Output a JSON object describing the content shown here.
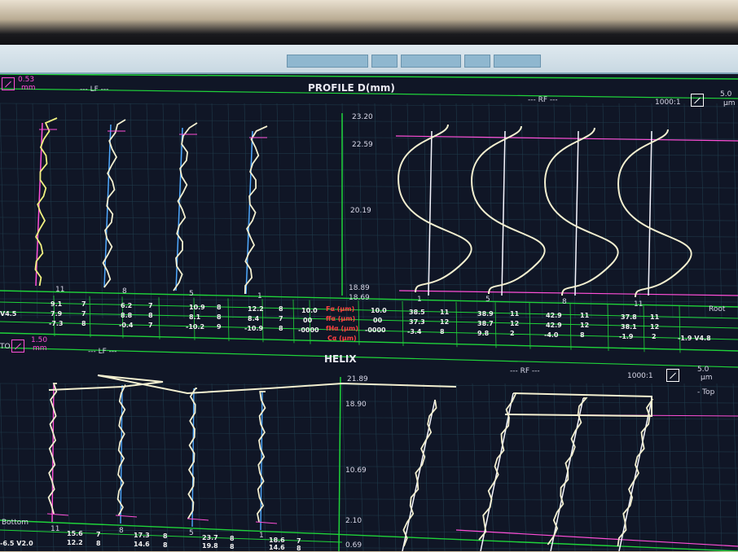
{
  "profile": {
    "zoom_left": "0.53",
    "zoom_left_unit": "mm",
    "lf_label": "--- LF ---",
    "title": "PROFILE D(mm)",
    "rf_label": "--- RF ---",
    "magnification": "1000:1",
    "scale_value": "5.0",
    "scale_unit": "μm",
    "axis_labels": [
      "23.20",
      "22.59",
      "20.19",
      "18.89",
      "18.69"
    ],
    "tooth_numbers_left": [
      "11",
      "8",
      "5",
      "1"
    ],
    "tooth_numbers_right": [
      "1",
      "5",
      "8",
      "11"
    ],
    "root_label": "Root",
    "rows": [
      {
        "left_label": "V4.5",
        "lf": [
          "9.1",
          "7",
          "6.2",
          "7",
          "10.9",
          "8",
          "12.2",
          "8"
        ],
        "mid_left": "10.0",
        "param": "Fα (μm)",
        "mid_right": "10.0",
        "rf": [
          "38.5",
          "11",
          "38.9",
          "11",
          "42.9",
          "11",
          "37.8",
          "11"
        ],
        "right_label": ""
      },
      {
        "left_label": "",
        "lf": [
          "7.9",
          "7",
          "8.8",
          "8",
          "8.1",
          "8",
          "8.4",
          "7"
        ],
        "mid_left": "00",
        "param": "ffα (μm)",
        "mid_right": "00",
        "rf": [
          "37.3",
          "12",
          "38.7",
          "12",
          "42.9",
          "12",
          "38.1",
          "12"
        ],
        "right_label": ""
      },
      {
        "left_label": "",
        "lf": [
          "-7.3",
          "8",
          "-0.4",
          "7",
          "-10.2",
          "9",
          "-10.9",
          "8"
        ],
        "mid_left": "-0000",
        "param": "fHα (μm)",
        "mid_right": "-0000",
        "rf": [
          "-3.4",
          "8",
          "9.8",
          "2",
          "-4.0",
          "8",
          "-1.9",
          "2"
        ],
        "right_label": "-1.9 V4.8"
      },
      {
        "left_label": "",
        "lf": [],
        "mid_left": "",
        "param": "Cα (μm)",
        "mid_right": "",
        "rf": [],
        "right_label": ""
      }
    ]
  },
  "helix": {
    "zoom_left_prefix": "TO",
    "zoom_left": "1.50",
    "zoom_left_unit": "mm",
    "lf_label": "--- LF ---",
    "title": "HELIX",
    "rf_label": "--- RF ---",
    "magnification": "1000:1",
    "scale_value": "5.0",
    "scale_unit": "μm",
    "top_label": "- Top",
    "bottom_label": "Bottom",
    "axis_labels": [
      "21.89",
      "18.90",
      "10.69",
      "2.10",
      "0.69"
    ],
    "tooth_numbers_left": [
      "11",
      "8",
      "5",
      "1"
    ],
    "bottom_rows": [
      {
        "left_label": "",
        "lf": [
          "15.6",
          "7",
          "17.3",
          "8",
          "23.7",
          "8",
          "18.6",
          "7"
        ]
      },
      {
        "left_label": "-6.5 V2.0",
        "lf": [
          "12.2",
          "8",
          "14.6",
          "8",
          "19.8",
          "8",
          "14.6",
          "8"
        ]
      }
    ]
  },
  "colors": {
    "screen_bg": "#101626",
    "grid": "#1f3a4a",
    "green_line": "#1fd33a",
    "magenta": "#ff4fd8",
    "trace": "#f4f0d0",
    "blue_ref": "#4fa9ff"
  }
}
